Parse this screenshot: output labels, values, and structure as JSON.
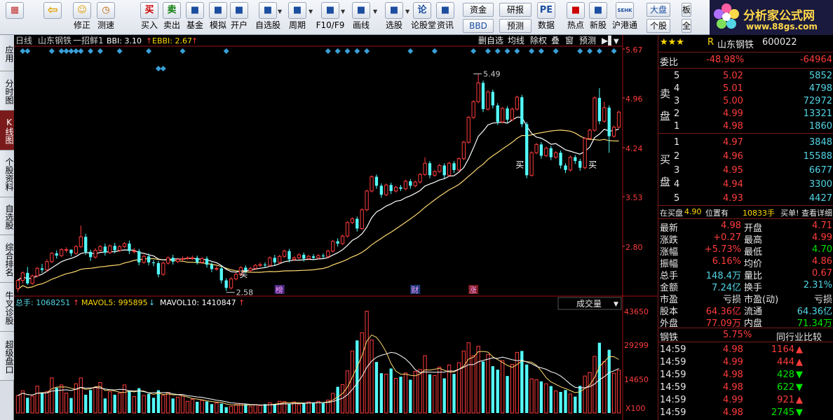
{
  "toolbar": {
    "buttons": [
      {
        "label": "",
        "icon": "window-grid-icon"
      },
      {
        "label": "",
        "icon": "back-arrow-icon"
      },
      {
        "label": "修正",
        "icon": "adjust-icon"
      },
      {
        "label": "测速",
        "icon": "speed-test-icon"
      },
      {
        "label": "买入",
        "icon": "buy-icon",
        "glyph": "买"
      },
      {
        "label": "卖出",
        "icon": "sell-icon",
        "glyph": "卖"
      },
      {
        "label": "基金",
        "icon": "fund-icon"
      },
      {
        "label": "模拟",
        "icon": "simulate-icon"
      },
      {
        "label": "开户",
        "icon": "open-account-icon"
      },
      {
        "label": "自选股",
        "icon": "favorites-icon"
      },
      {
        "label": "周期",
        "icon": "period-icon"
      },
      {
        "label": "F10/F9",
        "icon": "f10-icon"
      },
      {
        "label": "画线",
        "icon": "draw-line-icon"
      },
      {
        "label": "选股",
        "icon": "stock-picker-icon"
      },
      {
        "label": "论股堂",
        "icon": "forum-icon",
        "glyph": "论"
      },
      {
        "label": "资讯",
        "icon": "news-icon"
      },
      {
        "label": "数据",
        "icon": "data-icon",
        "glyph": "PE"
      },
      {
        "label": "热点",
        "icon": "hotspot-icon"
      },
      {
        "label": "新股",
        "icon": "new-stock-icon"
      },
      {
        "label": "沪港通",
        "icon": "shhk-connect-icon",
        "glyph": "SEHK"
      }
    ],
    "small_buttons": [
      "资金",
      "研报",
      "BBD",
      "预测",
      "大盘",
      "板",
      "个股",
      "全"
    ]
  },
  "logo": {
    "title": "分析家公式网",
    "url": "www.88gs.com"
  },
  "side_tabs": [
    "应用",
    "分时图",
    "K线图",
    "个股资料",
    "自选股",
    "综合排名",
    "牛叉诊股",
    "超级盘口"
  ],
  "active_tab": "K线图",
  "kpanel": {
    "period": "日线",
    "stock": "山东钢铁",
    "formula": "一招鲜1",
    "bbi_label": "BBI: 3.10",
    "ebbi_label": "EBBI: 2.67",
    "menu": [
      "删自选",
      "均线",
      "除权",
      "叠",
      "窗",
      "预测"
    ],
    "events": [
      "榜",
      "财",
      "涨"
    ],
    "buy_label": "买"
  },
  "vpanel": {
    "total_label": "总手: 1068251",
    "mavol5_label": "MAVOL5: 995895",
    "mavol10_label": "MAVOL10: 1410847",
    "dropdown": "成交量",
    "unit": "X100"
  },
  "chart_data": {
    "type": "candlestick",
    "price_axis": {
      "ticks": [
        "5.67",
        "4.96",
        "4.24",
        "3.53",
        "2.80"
      ],
      "range": [
        2.54,
        5.84
      ]
    },
    "volume_axis": {
      "ticks": [
        "43650",
        "29299",
        "14650"
      ],
      "range": [
        0,
        43650
      ]
    },
    "high_label": "5.49",
    "low_label": "2.58",
    "candles": [
      [
        2.63,
        2.74,
        2.58,
        2.76
      ],
      [
        2.74,
        2.84,
        2.7,
        2.86
      ],
      [
        2.84,
        2.7,
        2.68,
        2.92
      ],
      [
        2.7,
        2.8,
        2.68,
        2.82
      ],
      [
        2.8,
        2.9,
        2.78,
        2.92
      ],
      [
        2.9,
        2.88,
        2.84,
        2.96
      ],
      [
        2.88,
        2.99,
        2.86,
        3.02
      ],
      [
        2.99,
        3.1,
        2.97,
        3.12
      ],
      [
        3.1,
        3.07,
        3.03,
        3.14
      ],
      [
        3.07,
        3.15,
        3.05,
        3.17
      ],
      [
        3.15,
        3.15,
        3.11,
        3.18
      ],
      [
        3.15,
        3.1,
        3.06,
        3.14
      ],
      [
        3.1,
        3.19,
        3.08,
        3.21
      ],
      [
        3.19,
        3.32,
        3.17,
        3.47
      ],
      [
        3.32,
        3.12,
        3.08,
        3.36
      ],
      [
        3.12,
        3.05,
        3.0,
        3.15
      ],
      [
        3.05,
        3.14,
        3.03,
        3.17
      ],
      [
        3.14,
        3.19,
        3.12,
        3.21
      ],
      [
        3.19,
        3.11,
        3.07,
        3.23
      ],
      [
        3.11,
        3.2,
        3.09,
        3.22
      ],
      [
        3.2,
        3.14,
        3.1,
        3.24
      ],
      [
        3.14,
        3.19,
        3.12,
        3.21
      ],
      [
        3.19,
        3.23,
        3.17,
        3.25
      ],
      [
        3.23,
        3.13,
        3.09,
        3.27
      ],
      [
        3.13,
        3.13,
        3.1,
        3.17
      ],
      [
        3.13,
        2.98,
        2.94,
        3.16
      ],
      [
        2.98,
        3.06,
        2.96,
        3.08
      ],
      [
        3.06,
        2.98,
        2.94,
        3.1
      ],
      [
        2.98,
        2.97,
        2.93,
        3.01
      ],
      [
        2.97,
        2.82,
        2.78,
        3.0
      ],
      [
        2.82,
        2.97,
        2.8,
        2.99
      ],
      [
        2.97,
        3.04,
        2.95,
        3.06
      ],
      [
        3.04,
        2.99,
        2.95,
        3.08
      ],
      [
        2.99,
        3.02,
        2.97,
        3.04
      ],
      [
        3.02,
        3.03,
        3.0,
        3.06
      ],
      [
        3.03,
        3.04,
        3.01,
        3.06
      ],
      [
        3.04,
        3.04,
        3.01,
        3.07
      ],
      [
        3.04,
        2.98,
        2.95,
        3.07
      ],
      [
        2.98,
        3.03,
        2.96,
        3.05
      ],
      [
        3.03,
        2.95,
        2.91,
        3.06
      ],
      [
        2.95,
        2.89,
        2.85,
        2.98
      ],
      [
        2.89,
        2.9,
        2.87,
        2.93
      ],
      [
        2.9,
        2.74,
        2.7,
        2.93
      ],
      [
        2.74,
        2.64,
        2.6,
        2.77
      ],
      [
        2.64,
        2.76,
        2.62,
        2.78
      ],
      [
        2.76,
        2.82,
        2.74,
        2.84
      ],
      [
        2.82,
        2.91,
        2.8,
        2.93
      ],
      [
        2.91,
        2.87,
        2.83,
        2.94
      ],
      [
        2.87,
        2.9,
        2.85,
        2.92
      ],
      [
        2.9,
        2.94,
        2.88,
        2.96
      ],
      [
        2.94,
        2.95,
        2.92,
        2.98
      ],
      [
        2.95,
        2.94,
        2.91,
        2.98
      ],
      [
        2.94,
        3.04,
        2.92,
        3.06
      ],
      [
        3.04,
        2.98,
        2.94,
        3.08
      ],
      [
        2.98,
        3.06,
        2.96,
        3.08
      ],
      [
        3.06,
        3.13,
        3.04,
        3.15
      ],
      [
        3.13,
        3.02,
        2.98,
        3.16
      ],
      [
        3.02,
        3.04,
        3.0,
        3.06
      ],
      [
        3.04,
        3.08,
        3.02,
        3.1
      ],
      [
        3.08,
        3.03,
        2.99,
        3.11
      ],
      [
        3.03,
        3.06,
        3.01,
        3.08
      ],
      [
        3.06,
        3.04,
        3.01,
        3.09
      ],
      [
        3.04,
        3.07,
        3.02,
        3.09
      ],
      [
        3.07,
        3.06,
        3.03,
        3.1
      ],
      [
        3.06,
        3.13,
        3.04,
        3.15
      ],
      [
        3.13,
        3.26,
        3.11,
        3.28
      ],
      [
        3.26,
        3.23,
        3.19,
        3.3
      ],
      [
        3.23,
        3.33,
        3.21,
        3.35
      ],
      [
        3.33,
        3.51,
        3.31,
        3.53
      ],
      [
        3.51,
        3.56,
        3.49,
        3.58
      ],
      [
        3.56,
        3.43,
        3.39,
        3.59
      ],
      [
        3.43,
        3.68,
        3.41,
        3.7
      ],
      [
        3.68,
        3.93,
        3.66,
        3.95
      ],
      [
        3.93,
        4.12,
        3.91,
        4.14
      ],
      [
        4.12,
        4.0,
        3.96,
        4.15
      ],
      [
        4.0,
        3.88,
        3.84,
        4.03
      ],
      [
        3.88,
        4.01,
        3.86,
        4.03
      ],
      [
        4.01,
        3.93,
        3.89,
        4.04
      ],
      [
        3.93,
        3.98,
        3.91,
        4.0
      ],
      [
        3.98,
        3.96,
        3.93,
        4.01
      ],
      [
        3.96,
        4.06,
        3.94,
        4.08
      ],
      [
        4.06,
        4.0,
        3.96,
        4.09
      ],
      [
        4.0,
        4.05,
        3.98,
        4.07
      ],
      [
        4.05,
        4.15,
        4.03,
        4.17
      ],
      [
        4.15,
        4.3,
        4.13,
        4.38
      ],
      [
        4.3,
        4.14,
        4.1,
        4.33
      ],
      [
        4.14,
        4.19,
        4.12,
        4.21
      ],
      [
        4.19,
        4.27,
        4.17,
        4.29
      ],
      [
        4.27,
        4.14,
        4.1,
        4.3
      ],
      [
        4.14,
        4.3,
        4.12,
        4.32
      ],
      [
        4.3,
        4.21,
        4.17,
        4.33
      ],
      [
        4.21,
        4.36,
        4.19,
        4.38
      ],
      [
        4.36,
        4.58,
        4.34,
        4.6
      ],
      [
        4.58,
        4.91,
        4.56,
        4.93
      ],
      [
        4.91,
        5.12,
        4.89,
        5.14
      ],
      [
        5.12,
        5.37,
        5.1,
        5.49
      ],
      [
        5.37,
        5.02,
        4.98,
        5.4
      ],
      [
        5.02,
        5.25,
        5.0,
        5.27
      ],
      [
        5.25,
        5.07,
        5.03,
        5.28
      ],
      [
        5.07,
        4.85,
        4.81,
        5.1
      ],
      [
        4.85,
        5.03,
        4.83,
        5.05
      ],
      [
        5.03,
        4.88,
        4.84,
        5.06
      ],
      [
        4.88,
        5.02,
        4.86,
        5.04
      ],
      [
        5.02,
        5.18,
        5.0,
        5.2
      ],
      [
        5.18,
        4.82,
        4.78,
        5.21
      ],
      [
        4.82,
        4.14,
        4.1,
        4.85
      ],
      [
        4.14,
        4.44,
        4.12,
        4.46
      ],
      [
        4.44,
        4.55,
        4.42,
        4.57
      ],
      [
        4.55,
        4.4,
        4.36,
        4.58
      ],
      [
        4.4,
        4.5,
        4.38,
        4.52
      ],
      [
        4.5,
        4.38,
        4.34,
        4.53
      ],
      [
        4.38,
        4.44,
        4.36,
        4.46
      ],
      [
        4.44,
        4.27,
        4.23,
        4.47
      ],
      [
        4.27,
        4.21,
        4.17,
        4.3
      ],
      [
        4.21,
        4.38,
        4.19,
        4.4
      ],
      [
        4.38,
        4.33,
        4.29,
        4.41
      ],
      [
        4.33,
        4.24,
        4.2,
        4.36
      ],
      [
        4.24,
        4.63,
        4.22,
        4.65
      ],
      [
        4.63,
        4.74,
        4.61,
        4.76
      ],
      [
        4.74,
        5.17,
        4.72,
        5.19
      ],
      [
        5.17,
        4.86,
        4.82,
        5.3
      ],
      [
        4.86,
        5.04,
        4.84,
        5.12
      ],
      [
        5.04,
        4.66,
        4.44,
        5.07
      ],
      [
        4.66,
        4.78,
        4.64,
        4.8
      ],
      [
        4.78,
        4.98,
        4.76,
        5.0
      ]
    ],
    "volumes": [
      7500,
      9500,
      6500,
      7200,
      11500,
      8800,
      9200,
      15000,
      10800,
      12000,
      8500,
      6400,
      12500,
      15000,
      7800,
      9800,
      11000,
      13000,
      6200,
      9100,
      7800,
      8500,
      12000,
      9600,
      7000,
      10600,
      7500,
      8200,
      6500,
      9700,
      7500,
      8800,
      6200,
      6800,
      7300,
      5000,
      5800,
      4800,
      5400,
      4900,
      3800,
      4300,
      4000,
      2500,
      2800,
      3600,
      4000,
      3700,
      2700,
      3600,
      3200,
      3800,
      4400,
      3800,
      5000,
      4900,
      3800,
      4700,
      3600,
      4300,
      4800,
      4300,
      5000,
      4200,
      5500,
      8400,
      11200,
      12100,
      18000,
      26500,
      31000,
      34300,
      43500,
      31200,
      21800,
      17000,
      16600,
      19000,
      14800,
      15500,
      17100,
      14200,
      17800,
      18600,
      24500,
      16500,
      16000,
      19600,
      14800,
      20500,
      16700,
      21500,
      26500,
      30000,
      24500,
      28500,
      22000,
      25000,
      20000,
      18500,
      22400,
      15800,
      20800,
      25900,
      26500,
      20700,
      14600,
      14200,
      13500,
      12500,
      11500,
      9400,
      9000,
      9800,
      8100,
      7000,
      11600,
      15800,
      17300,
      24200,
      30000,
      22000,
      27000,
      17000,
      18300
    ]
  },
  "quote": {
    "stars": "★★★",
    "r_mark": "R",
    "name": "山东钢铁",
    "code": "600022",
    "weibi_label": "委比",
    "weibi_pct": "-48.98%",
    "weibi_diff": "-64964",
    "sell_label": [
      "卖",
      "盘"
    ],
    "buy_label": [
      "买",
      "盘"
    ],
    "sell": [
      {
        "lvl": "5",
        "price": "5.02",
        "vol": "5852"
      },
      {
        "lvl": "4",
        "price": "5.01",
        "vol": "4798"
      },
      {
        "lvl": "3",
        "price": "5.00",
        "vol": "72972"
      },
      {
        "lvl": "2",
        "price": "4.99",
        "vol": "13321"
      },
      {
        "lvl": "1",
        "price": "4.98",
        "vol": "1860"
      }
    ],
    "buy": [
      {
        "lvl": "1",
        "price": "4.97",
        "vol": "3848"
      },
      {
        "lvl": "2",
        "price": "4.96",
        "vol": "15588"
      },
      {
        "lvl": "3",
        "price": "4.95",
        "vol": "6677"
      },
      {
        "lvl": "4",
        "price": "4.94",
        "vol": "3300"
      },
      {
        "lvl": "5",
        "price": "4.93",
        "vol": "4427"
      }
    ],
    "notice": {
      "part1": "在买盘",
      "price": "4.90",
      "part2": "位置有",
      "vol": "10833手",
      "part3": "买单! 查看详细"
    },
    "stats": [
      [
        "最新",
        "4.98",
        "开盘",
        "4.71"
      ],
      [
        "涨跌",
        "+0.27",
        "最高",
        "4.99"
      ],
      [
        "涨幅",
        "+5.73%",
        "最低",
        "4.70"
      ],
      [
        "振幅",
        "6.16%",
        "均价",
        "4.86"
      ],
      [
        "总手",
        "148.4万",
        "量比",
        "0.67"
      ],
      [
        "金额",
        "7.24亿",
        "换手",
        "2.31%"
      ],
      [
        "市盈",
        "亏损",
        "市盈(动)",
        "亏损"
      ],
      [
        "股本",
        "64.36亿",
        "流通",
        "64.36亿"
      ],
      [
        "外盘",
        "77.09万",
        "内盘",
        "71.34万"
      ]
    ],
    "sector": {
      "name": "钢铁",
      "pct": "5.75%",
      "compare": "同行业比较"
    },
    "ticks": [
      {
        "time": "14:59",
        "price": "4.98",
        "vol": "1164",
        "dir": "up"
      },
      {
        "time": "14:59",
        "price": "4.99",
        "vol": "444",
        "dir": "up"
      },
      {
        "time": "14:59",
        "price": "4.98",
        "vol": "428",
        "dir": "down"
      },
      {
        "time": "14:59",
        "price": "4.98",
        "vol": "622",
        "dir": "down"
      },
      {
        "time": "14:59",
        "price": "4.99",
        "vol": "921",
        "dir": "up"
      },
      {
        "time": "14:59",
        "price": "4.98",
        "vol": "2745",
        "dir": "down"
      }
    ]
  }
}
